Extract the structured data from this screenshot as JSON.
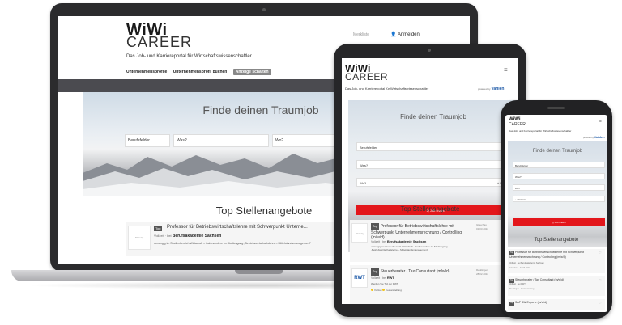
{
  "brand": {
    "logo_top": "WiWi",
    "logo_bottom": "CAREER",
    "tagline": "Das Job- und Karriereportal für Wirtschaftswissenschaftler",
    "powered_by": "powered by",
    "powered_brand": "Vahlen"
  },
  "laptop": {
    "top_link": "Merkliste",
    "login": "Anmelden",
    "nav": [
      "Unternehmensprofile",
      "Unternehmensprofil buchen",
      "Anzeige schalten"
    ],
    "hero_title": "Finde deinen Traumjob",
    "fields": [
      "Berufsfelder",
      "Was?",
      "Wo?"
    ],
    "top_title": "Top Stellenangebote",
    "job": {
      "logo_text": "Ministry",
      "tag": "Top",
      "title": "Professor für Betriebswirtschaftslehre mit Schwerpunkt Unterne...",
      "sub_prefix": "Vollzeit · bei",
      "company": "Berufsakademie Sachsen",
      "desc": "vorrangig im Studienbereich Wirtschaft – insbesondere im Studiengang „Betriebswirtschaftslehre – Mittelstandsmanagement\""
    }
  },
  "tablet": {
    "menu_icon": "≡",
    "hero_title": "Finde deinen Traumjob",
    "fields": [
      "Berufsfelder",
      "Was?",
      "Wo?"
    ],
    "radius": "+ Umkreis",
    "button": "Q  Job finden",
    "top_title": "Top Stellenangebote",
    "jobs": [
      {
        "logo_text": "Ministry",
        "tag": "Top",
        "title": "Professor für Betriebswirtschaftslehre mit Schwerpunkt Unternehmensrechnung / Controlling (m/w/d)",
        "sub_prefix": "Vollzeit · bei",
        "company": "Berufsakademie Sachsen",
        "desc": "vorrangig im Studienbereich Wirtschaft – insbesondere im Studiengang „Betriebswirtschaftslehre – Mittelstandsmanagement\"",
        "meta": [
          "Glauchau",
          "01.03.2022"
        ]
      },
      {
        "logo_text": "RWT",
        "tag": "Top",
        "title": "Steuerberater / Tax Consultant (m/w/d)",
        "sub_prefix": "Vollzeit · bei",
        "company": "RWT",
        "desc": "Werden Sie Teil der RWT",
        "chips": [
          "Vollzeit",
          "Festanstellung"
        ],
        "meta": [
          "Reutlingen",
          "28.02.2022"
        ]
      }
    ]
  },
  "phone": {
    "menu_icon": "≡",
    "hero_title": "Finde deinen Traumjob",
    "fields": [
      "Berufsfelder",
      "Was?",
      "Wo?",
      "+ Umkreis"
    ],
    "button": "Q  Job finden",
    "top_title": "Top Stellenangebote",
    "jobs": [
      {
        "tag": "Top",
        "title": "Professor für Betriebswirtschaftslehre mit Schwerpunkt Unternehmensrechnung / Controlling (m/w/d)",
        "sub": "Vollzeit · bei Berufsakademie Sachsen",
        "meta": "Glauchau · 01.03.2022"
      },
      {
        "tag": "Top",
        "title": "Steuerberater / Tax Consultant (m/w/d)",
        "sub": "Vollzeit · bei RWT",
        "meta": "Reutlingen · Festanstellung"
      },
      {
        "tag": "Top",
        "title": "SAP BW Experte (m/w/d)",
        "sub": "",
        "meta": ""
      }
    ]
  },
  "colors": {
    "accent_red": "#e3161b",
    "vahlen_blue": "#1a57a6",
    "dark_bar": "#4b4b50"
  }
}
